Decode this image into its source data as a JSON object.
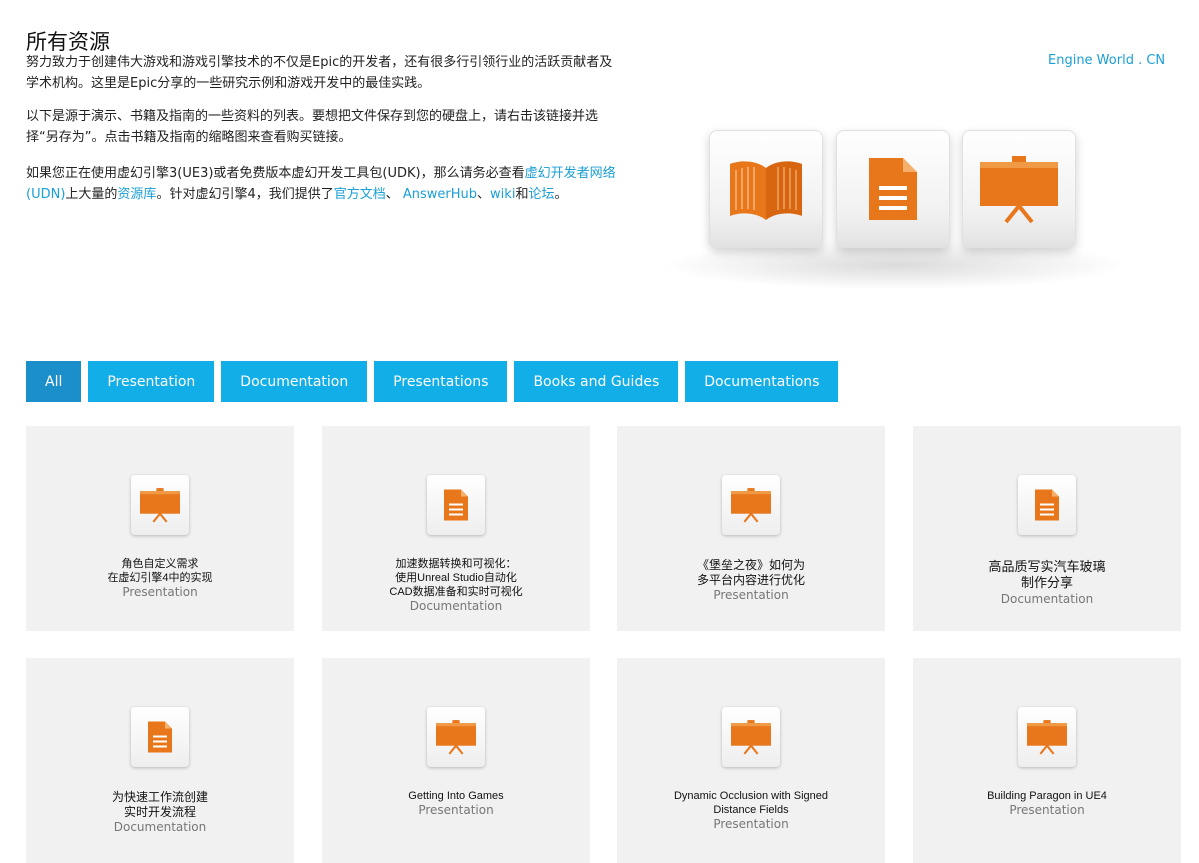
{
  "header": {
    "title": "所有资源",
    "engine_link": "Engine World . CN"
  },
  "intro": {
    "p1": "努力致力于创建伟大游戏和游戏引擎技术的不仅是Epic的开发者，还有很多行引领行业的活跃贡献者及学术机构。这里是Epic分享的一些研究示例和游戏开发中的最佳实践。",
    "p2": "以下是源于演示、书籍及指南的一些资料的列表。要想把文件保存到您的硬盘上，请右击该链接并选择“另存为”。点击书籍及指南的缩略图来查看购买链接。",
    "p3_a": "如果您正在使用虚幻引擎3(UE3)或者免费版本虚幻开发工具包(UDK)，那么请务必查看",
    "p3_udn": "虚幻开发者网络(UDN)",
    "p3_b": "上大量的",
    "p3_lib": "资源库",
    "p3_c": "。针对虚幻引擎4，我们提供了",
    "p3_docs": "官方文档",
    "p3_d": "、 ",
    "p3_answerhub": "AnswerHub",
    "p3_e": "、",
    "p3_wiki": "wiki",
    "p3_f": "和",
    "p3_forum": "论坛",
    "p3_g": "。"
  },
  "hero_icons": [
    "book-icon",
    "document-icon",
    "presentation-board-icon"
  ],
  "tabs": [
    {
      "label": "All",
      "active": true
    },
    {
      "label": "Presentation",
      "active": false
    },
    {
      "label": "Documentation",
      "active": false
    },
    {
      "label": "Presentations",
      "active": false
    },
    {
      "label": "Books and Guides",
      "active": false
    },
    {
      "label": "Documentations",
      "active": false
    }
  ],
  "cards": [
    {
      "title": "角色自定义需求\n在虚幻引擎4中的实现",
      "type": "Presentation",
      "icon": "presentation-board-icon"
    },
    {
      "title": "加速数据转换和可视化：\n使用Unreal Studio自动化\nCAD数据准备和实时可视化",
      "type": "Documentation",
      "icon": "document-icon"
    },
    {
      "title": "《堡垒之夜》如何为\n多平台内容进行优化",
      "type": "Presentation",
      "icon": "presentation-board-icon"
    },
    {
      "title": "高品质写实汽车玻璃\n制作分享",
      "type": "Documentation",
      "icon": "document-icon"
    },
    {
      "title": "为快速工作流创建\n实时开发流程",
      "type": "Documentation",
      "icon": "document-icon"
    },
    {
      "title": "Getting Into Games",
      "type": "Presentation",
      "icon": "presentation-board-icon"
    },
    {
      "title": "Dynamic Occlusion with Signed\nDistance Fields",
      "type": "Presentation",
      "icon": "presentation-board-icon"
    },
    {
      "title": "Building Paragon in UE4",
      "type": "Presentation",
      "icon": "presentation-board-icon"
    }
  ],
  "colors": {
    "accent": "#12aee8",
    "accent_active": "#1b8fc9",
    "link": "#1a9fd6",
    "icon_orange": "#e8761a",
    "card_bg": "#f1f1f1"
  }
}
